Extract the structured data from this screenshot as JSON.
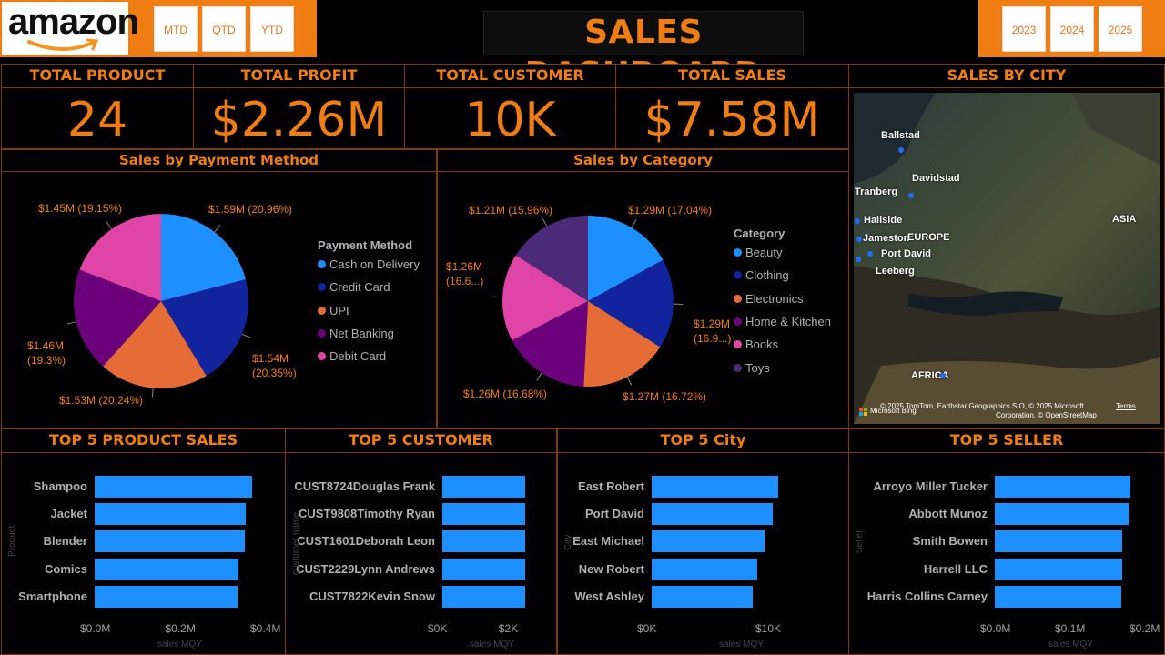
{
  "brand": {
    "logo_text": "amazon"
  },
  "period_filters": [
    "MTD",
    "QTD",
    "YTD"
  ],
  "year_filters": [
    "2023",
    "2024",
    "2025"
  ],
  "title": "SALES DASHBOARD",
  "kpis": [
    {
      "label": "TOTAL PRODUCT",
      "value": "24"
    },
    {
      "label": "TOTAL PROFIT",
      "value": "$2.26M"
    },
    {
      "label": "TOTAL CUSTOMER",
      "value": "10K"
    },
    {
      "label": "TOTAL SALES",
      "value": "$7.58M"
    }
  ],
  "map": {
    "title": "SALES BY CITY",
    "labels": [
      "Ballstad",
      "Davidstad",
      "Tranberg",
      "Hallside",
      "Jameston",
      "EUROPE",
      "Port David",
      "Leeberg",
      "ASIA",
      "AFRICA"
    ],
    "credit_line1": "© 2025 TomTom, Earthstar Geographics SIO, © 2025 Microsoft",
    "credit_terms": "Terms",
    "credit_line2": "Corporation, © OpenStreetMap",
    "credit_brand": "Microsoft Bing"
  },
  "colors": {
    "accent": "#f07d11",
    "bar": "#1e8fff",
    "pie": [
      "#1e8fff",
      "#12239e",
      "#e66c37",
      "#6b007b",
      "#e044a7",
      "#4b2a7a"
    ]
  },
  "payment_chart": {
    "title": "Sales by Payment Method",
    "legend_title": "Payment Method",
    "labels_text": [
      "$1.59M (20.96%)",
      "$1.54M",
      "(20.35%)",
      "$1.53M (20.24%)",
      "$1.46M",
      "(19.3%)",
      "$1.45M (19.15%)"
    ]
  },
  "category_chart": {
    "title": "Sales by Category",
    "legend_title": "Category",
    "labels_text": [
      "$1.29M (17.04%)",
      "$1.29M",
      "(16.9...)",
      "$1.27M (16.72%)",
      "$1.26M (16.68%)",
      "$1.26M",
      "(16.6...)",
      "$1.21M (15.96%)"
    ]
  },
  "top_products": {
    "title": "TOP 5 PRODUCT SALES",
    "y_title": "Product",
    "x_title": "sales MQY",
    "ticks": [
      "$0.0M",
      "$0.2M",
      "$0.4M"
    ]
  },
  "top_customers": {
    "title": "TOP 5 CUSTOMER",
    "y_title": "customer name",
    "x_title": "sales MQY",
    "ticks": [
      "$0K",
      "$2K"
    ]
  },
  "top_cities": {
    "title": "TOP 5 City",
    "y_title": "City",
    "x_title": "sales MQY",
    "ticks": [
      "$0K",
      "$10K"
    ]
  },
  "top_sellers": {
    "title": "TOP 5 SELLER",
    "y_title": "Seller",
    "x_title": "sales MQY",
    "ticks": [
      "$0.0M",
      "$0.1M",
      "$0.2M"
    ]
  },
  "chart_data": [
    {
      "type": "pie",
      "title": "Sales by Payment Method",
      "categories": [
        "Cash on Delivery",
        "Credit Card",
        "UPI",
        "Net Banking",
        "Debit Card"
      ],
      "values": [
        1.59,
        1.54,
        1.53,
        1.46,
        1.45
      ],
      "percent": [
        20.96,
        20.35,
        20.24,
        19.3,
        19.15
      ],
      "unit": "$M",
      "legend": "right"
    },
    {
      "type": "pie",
      "title": "Sales by Category",
      "categories": [
        "Beauty",
        "Clothing",
        "Electronics",
        "Home & Kitchen",
        "Books",
        "Toys"
      ],
      "values": [
        1.29,
        1.29,
        1.27,
        1.26,
        1.26,
        1.21
      ],
      "percent": [
        17.04,
        16.9,
        16.72,
        16.68,
        16.6,
        15.96
      ],
      "unit": "$M",
      "legend": "right"
    },
    {
      "type": "bar",
      "title": "TOP 5 PRODUCT SALES",
      "categories": [
        "Shampoo",
        "Jacket",
        "Blender",
        "Comics",
        "Smartphone"
      ],
      "values": [
        0.37,
        0.355,
        0.352,
        0.338,
        0.336
      ],
      "xlim": [
        0,
        0.4
      ],
      "unit": "$M"
    },
    {
      "type": "bar",
      "title": "TOP 5 CUSTOMER",
      "categories": [
        "CUST8724Douglas Frank",
        "CUST9808Timothy Ryan",
        "CUST1601Deborah Leon",
        "CUST2229Lynn Andrews",
        "CUST7822Kevin Snow"
      ],
      "values": [
        2.35,
        2.35,
        2.35,
        2.35,
        2.35
      ],
      "xlim": [
        0,
        2.8
      ],
      "unit": "$K"
    },
    {
      "type": "bar",
      "title": "TOP 5 City",
      "categories": [
        "East Robert",
        "Port David",
        "East Michael",
        "New Robert",
        "West Ashley"
      ],
      "values": [
        10.7,
        10.2,
        9.5,
        8.9,
        8.5
      ],
      "xlim": [
        0,
        12
      ],
      "unit": "$K"
    },
    {
      "type": "bar",
      "title": "TOP 5 SELLER",
      "categories": [
        "Arroyo Miller Tucker",
        "Abbott Munoz",
        "Smith Bowen",
        "Harrell LLC",
        "Harris Collins Carney"
      ],
      "values": [
        0.182,
        0.179,
        0.171,
        0.171,
        0.17
      ],
      "xlim": [
        0,
        0.2
      ],
      "unit": "$M"
    }
  ]
}
